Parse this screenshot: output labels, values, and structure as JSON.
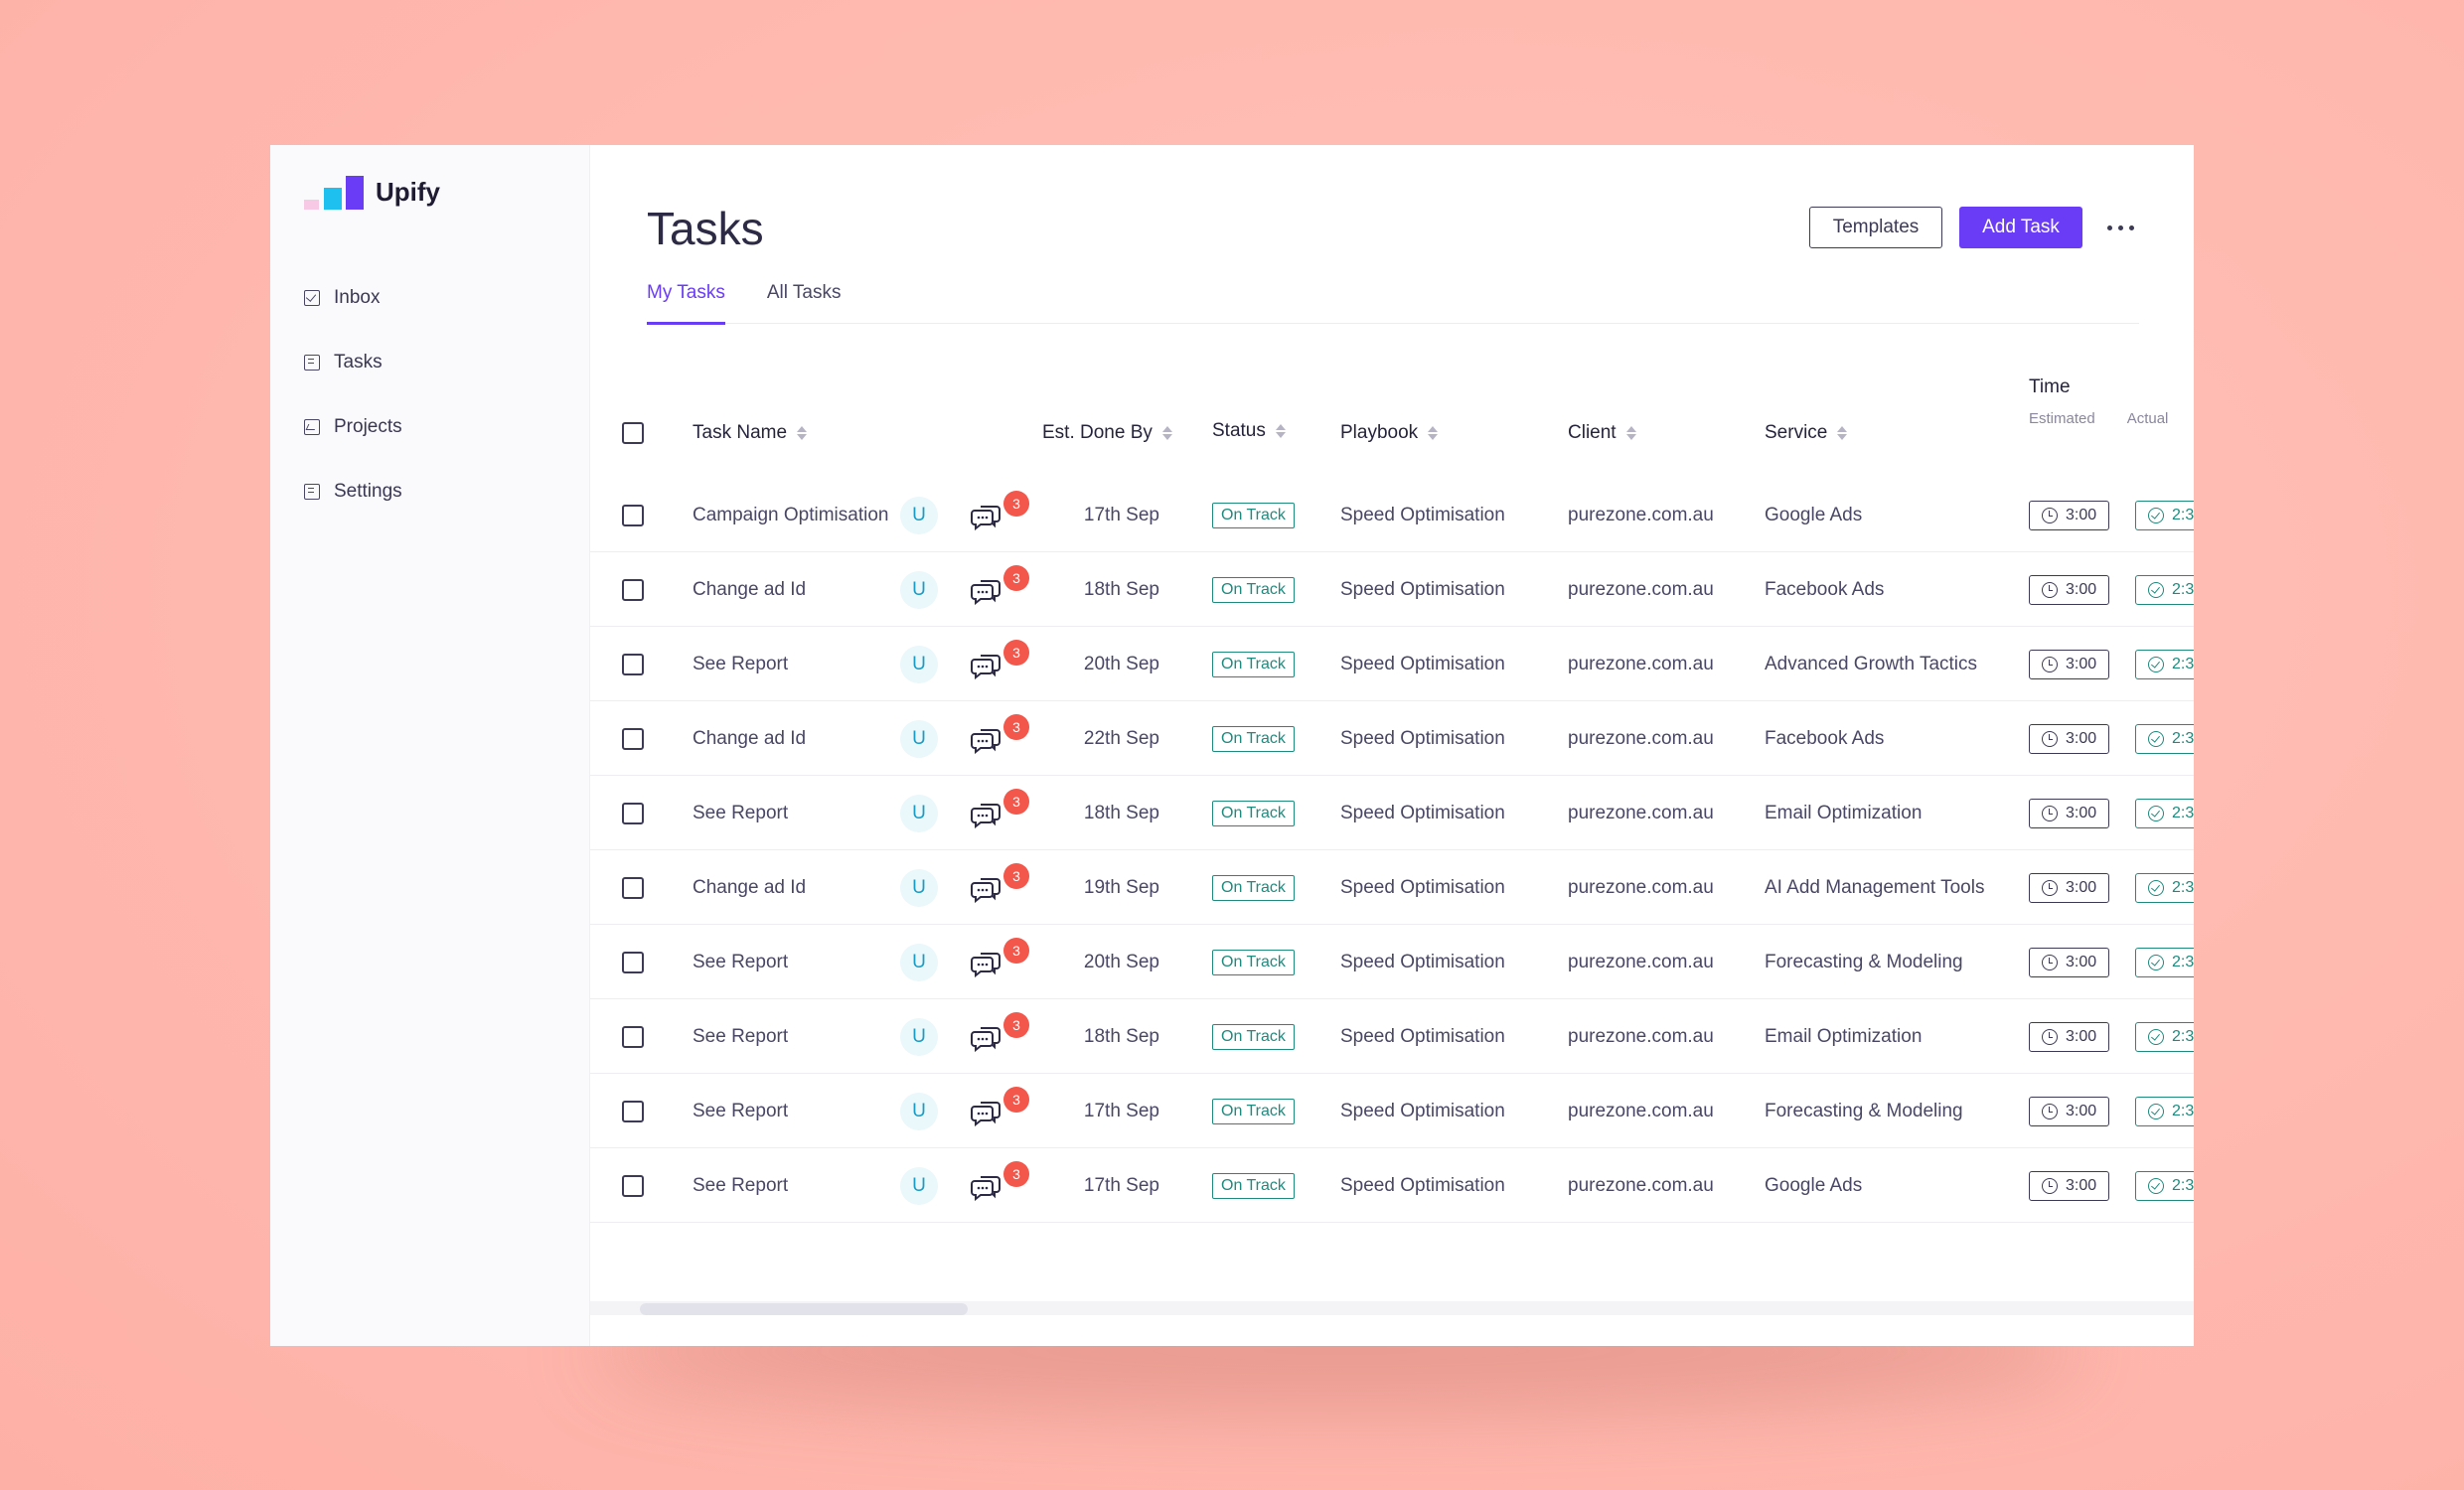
{
  "app": {
    "name": "Upify"
  },
  "sidebar": {
    "items": [
      {
        "label": "Inbox",
        "icon": "inbox-icon"
      },
      {
        "label": "Tasks",
        "icon": "tasks-icon"
      },
      {
        "label": "Projects",
        "icon": "projects-icon"
      },
      {
        "label": "Settings",
        "icon": "settings-icon"
      }
    ]
  },
  "header": {
    "title": "Tasks",
    "templates_label": "Templates",
    "add_task_label": "Add Task"
  },
  "tabs": [
    {
      "label": "My Tasks",
      "active": true
    },
    {
      "label": "All Tasks",
      "active": false
    }
  ],
  "table": {
    "columns": {
      "task_name": "Task Name",
      "done_by": "Est. Done By",
      "status": "Status",
      "playbook": "Playbook",
      "client": "Client",
      "service": "Service",
      "time": "Time",
      "time_estimated": "Estimated",
      "time_actual": "Actual"
    },
    "rows": [
      {
        "task": "Campaign Optimisation",
        "assignee": "U",
        "comments": "3",
        "done_by": "17th Sep",
        "status": "On Track",
        "playbook": "Speed Optimisation",
        "client": "purezone.com.au",
        "service": "Google Ads",
        "estimated": "3:00",
        "actual": "2:3"
      },
      {
        "task": "Change ad Id",
        "assignee": "U",
        "comments": "3",
        "done_by": "18th Sep",
        "status": "On Track",
        "playbook": "Speed Optimisation",
        "client": "purezone.com.au",
        "service": "Facebook Ads",
        "estimated": "3:00",
        "actual": "2:3"
      },
      {
        "task": "See Report",
        "assignee": "U",
        "comments": "3",
        "done_by": "20th Sep",
        "status": "On Track",
        "playbook": "Speed Optimisation",
        "client": "purezone.com.au",
        "service": "Advanced Growth Tactics",
        "estimated": "3:00",
        "actual": "2:3"
      },
      {
        "task": "Change ad Id",
        "assignee": "U",
        "comments": "3",
        "done_by": "22th Sep",
        "status": "On Track",
        "playbook": "Speed Optimisation",
        "client": "purezone.com.au",
        "service": "Facebook Ads",
        "estimated": "3:00",
        "actual": "2:3"
      },
      {
        "task": "See Report",
        "assignee": "U",
        "comments": "3",
        "done_by": "18th Sep",
        "status": "On Track",
        "playbook": "Speed Optimisation",
        "client": "purezone.com.au",
        "service": "Email Optimization",
        "estimated": "3:00",
        "actual": "2:3"
      },
      {
        "task": "Change ad Id",
        "assignee": "U",
        "comments": "3",
        "done_by": "19th Sep",
        "status": "On Track",
        "playbook": "Speed Optimisation",
        "client": "purezone.com.au",
        "service": "AI Add Management Tools",
        "estimated": "3:00",
        "actual": "2:3"
      },
      {
        "task": "See Report",
        "assignee": "U",
        "comments": "3",
        "done_by": "20th Sep",
        "status": "On Track",
        "playbook": "Speed Optimisation",
        "client": "purezone.com.au",
        "service": "Forecasting & Modeling",
        "estimated": "3:00",
        "actual": "2:3"
      },
      {
        "task": "See Report",
        "assignee": "U",
        "comments": "3",
        "done_by": "18th Sep",
        "status": "On Track",
        "playbook": "Speed Optimisation",
        "client": "purezone.com.au",
        "service": "Email Optimization",
        "estimated": "3:00",
        "actual": "2:3"
      },
      {
        "task": "See Report",
        "assignee": "U",
        "comments": "3",
        "done_by": "17th Sep",
        "status": "On Track",
        "playbook": "Speed Optimisation",
        "client": "purezone.com.au",
        "service": "Forecasting & Modeling",
        "estimated": "3:00",
        "actual": "2:3"
      },
      {
        "task": "See Report",
        "assignee": "U",
        "comments": "3",
        "done_by": "17th Sep",
        "status": "On Track",
        "playbook": "Speed Optimisation",
        "client": "purezone.com.au",
        "service": "Google Ads",
        "estimated": "3:00",
        "actual": "2:3"
      }
    ]
  },
  "colors": {
    "accent": "#6b3cf6",
    "status_green": "#1f8a7e",
    "badge_red": "#f3564a",
    "background": "#ffb8ae"
  }
}
